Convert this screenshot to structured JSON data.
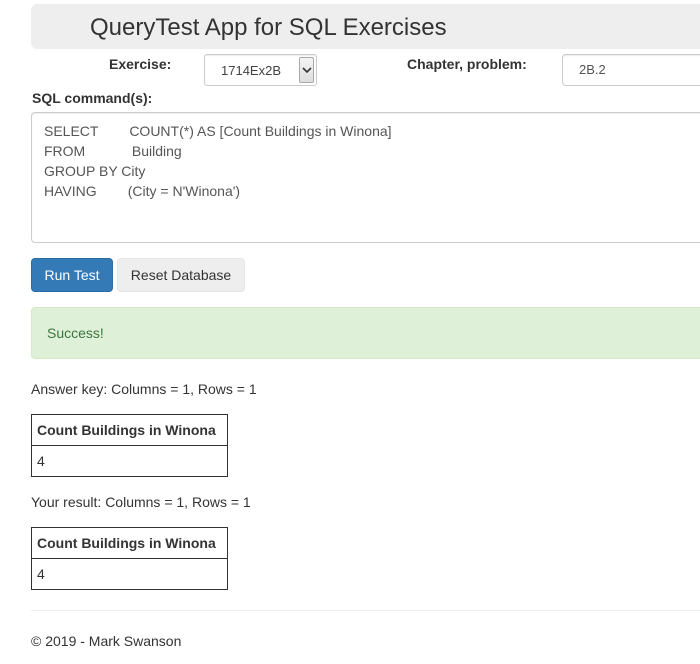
{
  "header": {
    "title": "QueryTest App for SQL Exercises"
  },
  "form": {
    "exercise_label": "Exercise:",
    "exercise_value": "1714Ex2B",
    "chapter_label": "Chapter, problem:",
    "chapter_value": "2B.2",
    "sql_label": "SQL command(s):",
    "sql_lines": [
      "SELECT        COUNT(*) AS [Count Buildings in Winona]",
      "FROM            Building",
      "GROUP BY City",
      "HAVING        (City = N'Winona')"
    ]
  },
  "buttons": {
    "run_label": "Run Test",
    "reset_label": "Reset Database"
  },
  "alert": {
    "text": "Success!",
    "color": "#dff0d8"
  },
  "answer_key": {
    "caption": "Answer key: Columns = 1, Rows = 1",
    "header": "Count Buildings in Winona",
    "rows": [
      "4"
    ]
  },
  "your_result": {
    "caption": "Your result: Columns = 1, Rows = 1",
    "header": "Count Buildings in Winona",
    "rows": [
      "4"
    ]
  },
  "footer": {
    "text": "© 2019 - Mark Swanson"
  },
  "colors": {
    "primary": "#337ab7",
    "success_text": "#3c763d"
  }
}
